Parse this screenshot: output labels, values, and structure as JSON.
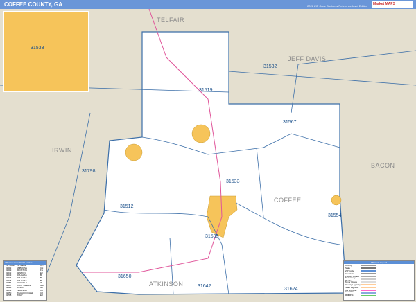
{
  "header": {
    "title": "COFFEE COUNTY, GA",
    "edition": "2026 ZIP Code Business Reference Inset Edition",
    "logo": "Market MAPS"
  },
  "inset": {
    "label": "31533"
  },
  "counties": [
    "TELFAIR",
    "JEFF DAVIS",
    "IRWIN",
    "BACON",
    "COFFEE",
    "ATKINSON"
  ],
  "zips": [
    "31519",
    "31532",
    "31567",
    "31798",
    "31512",
    "31533",
    "31554",
    "31535",
    "31650",
    "31642",
    "31624"
  ],
  "index": {
    "title": "ZIP Code Index/Grid Location",
    "columns": [
      "ZIP Code",
      "ZIP Name",
      "CTY"
    ],
    "rows": [
      [
        "31512",
        "AMBROSE",
        "CN"
      ],
      [
        "31519",
        "BROXTON",
        "FS"
      ],
      [
        "31532",
        "DENTON",
        "EJ"
      ],
      [
        "31533",
        "DOUGLAS",
        "BI"
      ],
      [
        "31534",
        "DOUGLAS",
        "BI"
      ],
      [
        "31535",
        "DOUGLAS",
        "BI"
      ],
      [
        "31554",
        "NICHOLLS",
        "IF"
      ],
      [
        "31567",
        "WEST GREEN",
        "GM"
      ],
      [
        "31624",
        "AXSON",
        "GT"
      ],
      [
        "31642",
        "PEARSON",
        "CV"
      ],
      [
        "31650",
        "WILLACOOCHEE",
        "CX"
      ],
      [
        "31798",
        "WRAY",
        "EX"
      ]
    ]
  },
  "legend": {
    "title": "ZIP Code Legend",
    "items": [
      "County",
      "State",
      "ZIP Code",
      "Interstate",
      "Primary Roads",
      "Secondary Roads",
      "Minor Roads",
      "County Highway",
      "State Highway",
      "US Highway",
      "Interstate Highway",
      "Rail Road"
    ],
    "colors": [
      "#999",
      "#777",
      "#5b8fd6",
      "#999",
      "#aaa",
      "#ccc",
      "#ddd",
      "#fc9",
      "#fc9",
      "#f6c",
      "#8ad",
      "#6c6"
    ]
  },
  "colors": {
    "land": "#e4dfcf",
    "county": "#ffffff",
    "boundary": "#3b6ea8",
    "urban": "#f6c45a",
    "highway": "#e0559a"
  }
}
